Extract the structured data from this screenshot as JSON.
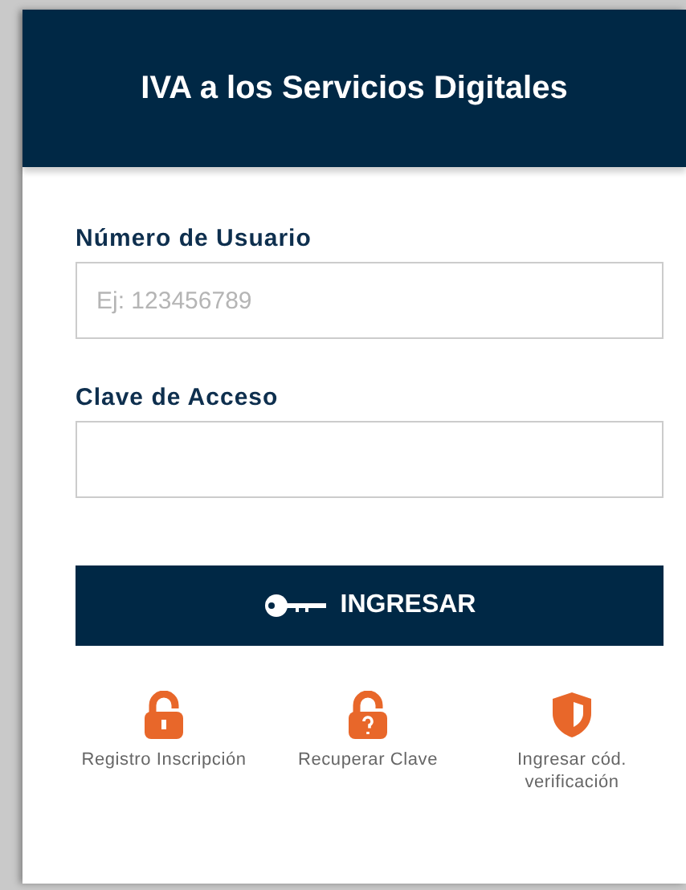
{
  "header": {
    "title": "IVA a los Servicios Digitales"
  },
  "fields": [
    {
      "label": "Número de Usuario",
      "placeholder": "Ej: 123456789"
    },
    {
      "label": "Clave de Acceso"
    }
  ],
  "submit": {
    "label": "INGRESAR"
  },
  "links": [
    {
      "kind": "lock",
      "label": "Registro Inscripción"
    },
    {
      "kind": "lock-question",
      "label": "Recuperar Clave"
    },
    {
      "kind": "shield",
      "label": "Ingresar cód. verificación"
    }
  ]
}
